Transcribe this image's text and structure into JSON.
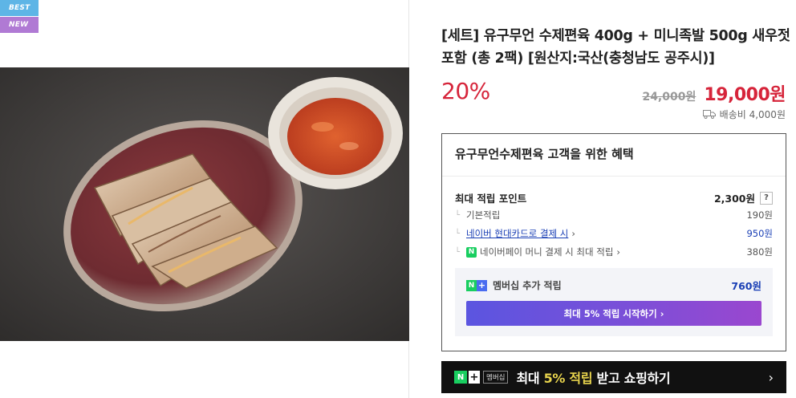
{
  "badges": {
    "best": "BEST",
    "new": "NEW"
  },
  "product": {
    "title": "[세트] 유구무언 수제편육 400g + 미니족발 500g 새우젓 포함 (총 2팩) [원산지:국산(충청남도 공주시)]",
    "discount": "20%",
    "original_price": "24,000원",
    "sale_price": "19,000원",
    "shipping": "배송비 4,000원"
  },
  "benefits": {
    "header": "유구무언수제편육 고객을 위한 혜택",
    "max_points_label": "최대 적립 포인트",
    "max_points_value": "2,300원",
    "help": "?",
    "rows": [
      {
        "label": "기본적립",
        "amount": "190원"
      },
      {
        "label": "네이버 현대카드로 결제 시",
        "amount": "950원"
      },
      {
        "label": "네이버페이 머니 결제 시 최대 적립",
        "amount": "380원"
      }
    ],
    "npay_mark": "N",
    "membership": {
      "label": "멤버십 추가 적립",
      "amount": "760원",
      "button": "최대 5% 적립 시작하기 ›",
      "n": "N",
      "plus": "+"
    }
  },
  "banner": {
    "n": "N",
    "plus": "+",
    "member_tag": "멤버십",
    "text_pre": "최대 ",
    "text_highlight": "5% 적립",
    "text_post": " 받고 쇼핑하기",
    "arrow": "›"
  },
  "colors": {
    "accent_red": "#d6243a",
    "link_blue": "#1a3fb5",
    "naver_green": "#19ce60",
    "badge_best": "#5eb5e6",
    "badge_new": "#b07ad4"
  }
}
